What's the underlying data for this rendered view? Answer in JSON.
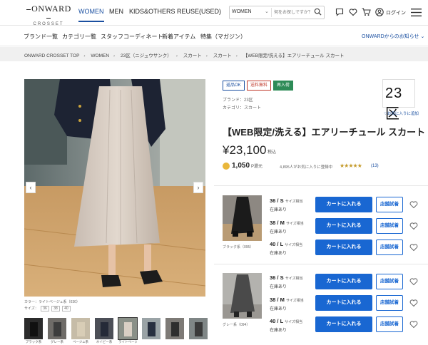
{
  "header": {
    "logo_main": "ONWARD",
    "logo_sub": "CROSSET",
    "nav": [
      "WOMEN",
      "MEN",
      "KIDS&OTHERS",
      "REUSE(USED)"
    ],
    "search_category": "WOMEN",
    "search_placeholder": "何をお探しですか？",
    "login_label": "ログイン"
  },
  "subnav": {
    "items": [
      "ブランド一覧",
      "カテゴリ一覧",
      "スタッフコーディネート",
      "新着アイテム",
      "特集（マガジン）"
    ],
    "right_label": "ONWARDからのお知らせ"
  },
  "breadcrumb": [
    "ONWARD CROSSET TOP",
    "WOMEN",
    "23区（ニジュウサンク）",
    "スカート",
    "スカート",
    "【WEB限定/洗える】エアリーチュール スカート"
  ],
  "gallery": {
    "color_caption": "カラー：ライトベージュ系（030）",
    "size_label": "サイズ：",
    "sizes": [
      "36",
      "38",
      "40"
    ],
    "thumb_labels": [
      "ブラック系",
      "グレー系",
      "ベージュ系",
      "ネイビー系",
      "ライトベージュ",
      "",
      "",
      ""
    ]
  },
  "product": {
    "tags": [
      "返品OK",
      "送料無料",
      "再入荷"
    ],
    "brand_line": "ブランド：23区",
    "category_line": "カテゴリ：スカート",
    "brand_logo": "23区",
    "brand_fav": "♡お気に入りに追加",
    "title": "【WEB限定/洗える】エアリーチュール スカート",
    "price": "¥23,100",
    "tax": "税込",
    "points": "1,050",
    "points_suffix": "P還元",
    "fav_count": "4,895人がお気に入りに登録中",
    "stars": "★★★★★",
    "review_count": "(13)"
  },
  "variants": [
    {
      "color_caption": "ブラック系（095）",
      "rows": [
        {
          "size": "36 / S",
          "size_note": "サイズ相当",
          "stock": "在庫あり",
          "cart": "カートに入れる",
          "store": "店舗試着"
        },
        {
          "size": "38 / M",
          "size_note": "サイズ相当",
          "stock": "在庫あり",
          "cart": "カートに入れる",
          "store": "店舗試着"
        },
        {
          "size": "40 / L",
          "size_note": "サイズ相当",
          "stock": "在庫あり",
          "cart": "カートに入れる",
          "store": "店舗試着"
        }
      ]
    },
    {
      "color_caption": "グレー系（094）",
      "rows": [
        {
          "size": "36 / S",
          "size_note": "サイズ相当",
          "stock": "在庫あり",
          "cart": "カートに入れる",
          "store": "店舗試着"
        },
        {
          "size": "38 / M",
          "size_note": "サイズ相当",
          "stock": "在庫あり",
          "cart": "カートに入れる",
          "store": "店舗試着"
        },
        {
          "size": "40 / L",
          "size_note": "サイズ相当",
          "stock": "在庫あり",
          "cart": "カートに入れる",
          "store": "店舗試着"
        }
      ]
    }
  ],
  "colors": {
    "accent": "#1967d2",
    "brand_blue": "#1a4fa0"
  },
  "icons": [
    "search-icon",
    "chat-icon",
    "favorite-icon",
    "cart-icon",
    "user-icon",
    "menu-icon",
    "chevron-left-icon",
    "chevron-right-icon",
    "heart-icon",
    "coin-icon"
  ]
}
